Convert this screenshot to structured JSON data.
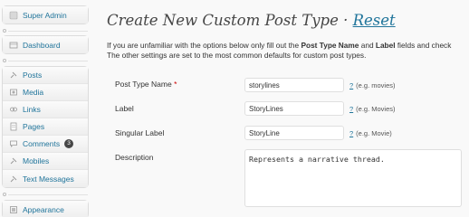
{
  "sidebar": {
    "top": {
      "label": "Super Admin",
      "icon": "user-icon"
    },
    "dashboard": {
      "label": "Dashboard",
      "icon": "dashboard-icon"
    },
    "items": [
      {
        "label": "Posts",
        "icon": "pin-icon"
      },
      {
        "label": "Media",
        "icon": "media-icon"
      },
      {
        "label": "Links",
        "icon": "links-icon"
      },
      {
        "label": "Pages",
        "icon": "pages-icon"
      },
      {
        "label": "Comments",
        "icon": "comments-icon",
        "badge": "3"
      },
      {
        "label": "Mobiles",
        "icon": "pin-icon"
      },
      {
        "label": "Text Messages",
        "icon": "pin-icon"
      }
    ],
    "appearance": {
      "label": "Appearance",
      "icon": "appearance-icon"
    }
  },
  "page": {
    "title": "Create New Custom Post Type ·",
    "reset_link": "Reset",
    "intro": {
      "part1": "If you are unfamiliar with the options below only fill out the",
      "bold1": "Post Type Name",
      "part2": "and",
      "bold2": "Label",
      "part3": "fields and check",
      "line2": "The other settings are set to the most common defaults for custom post types."
    }
  },
  "form": {
    "post_type_name": {
      "label": "Post Type Name",
      "required_mark": "*",
      "value": "storylines",
      "help_link": "?",
      "help": "(e.g. movies)"
    },
    "label": {
      "label": "Label",
      "value": "StoryLines",
      "help_link": "?",
      "help": "(e.g. Movies)"
    },
    "singular_label": {
      "label": "Singular Label",
      "value": "StoryLine",
      "help_link": "?",
      "help": "(e.g. Movie)"
    },
    "description": {
      "label": "Description",
      "value": "Represents a narrative thread."
    }
  }
}
